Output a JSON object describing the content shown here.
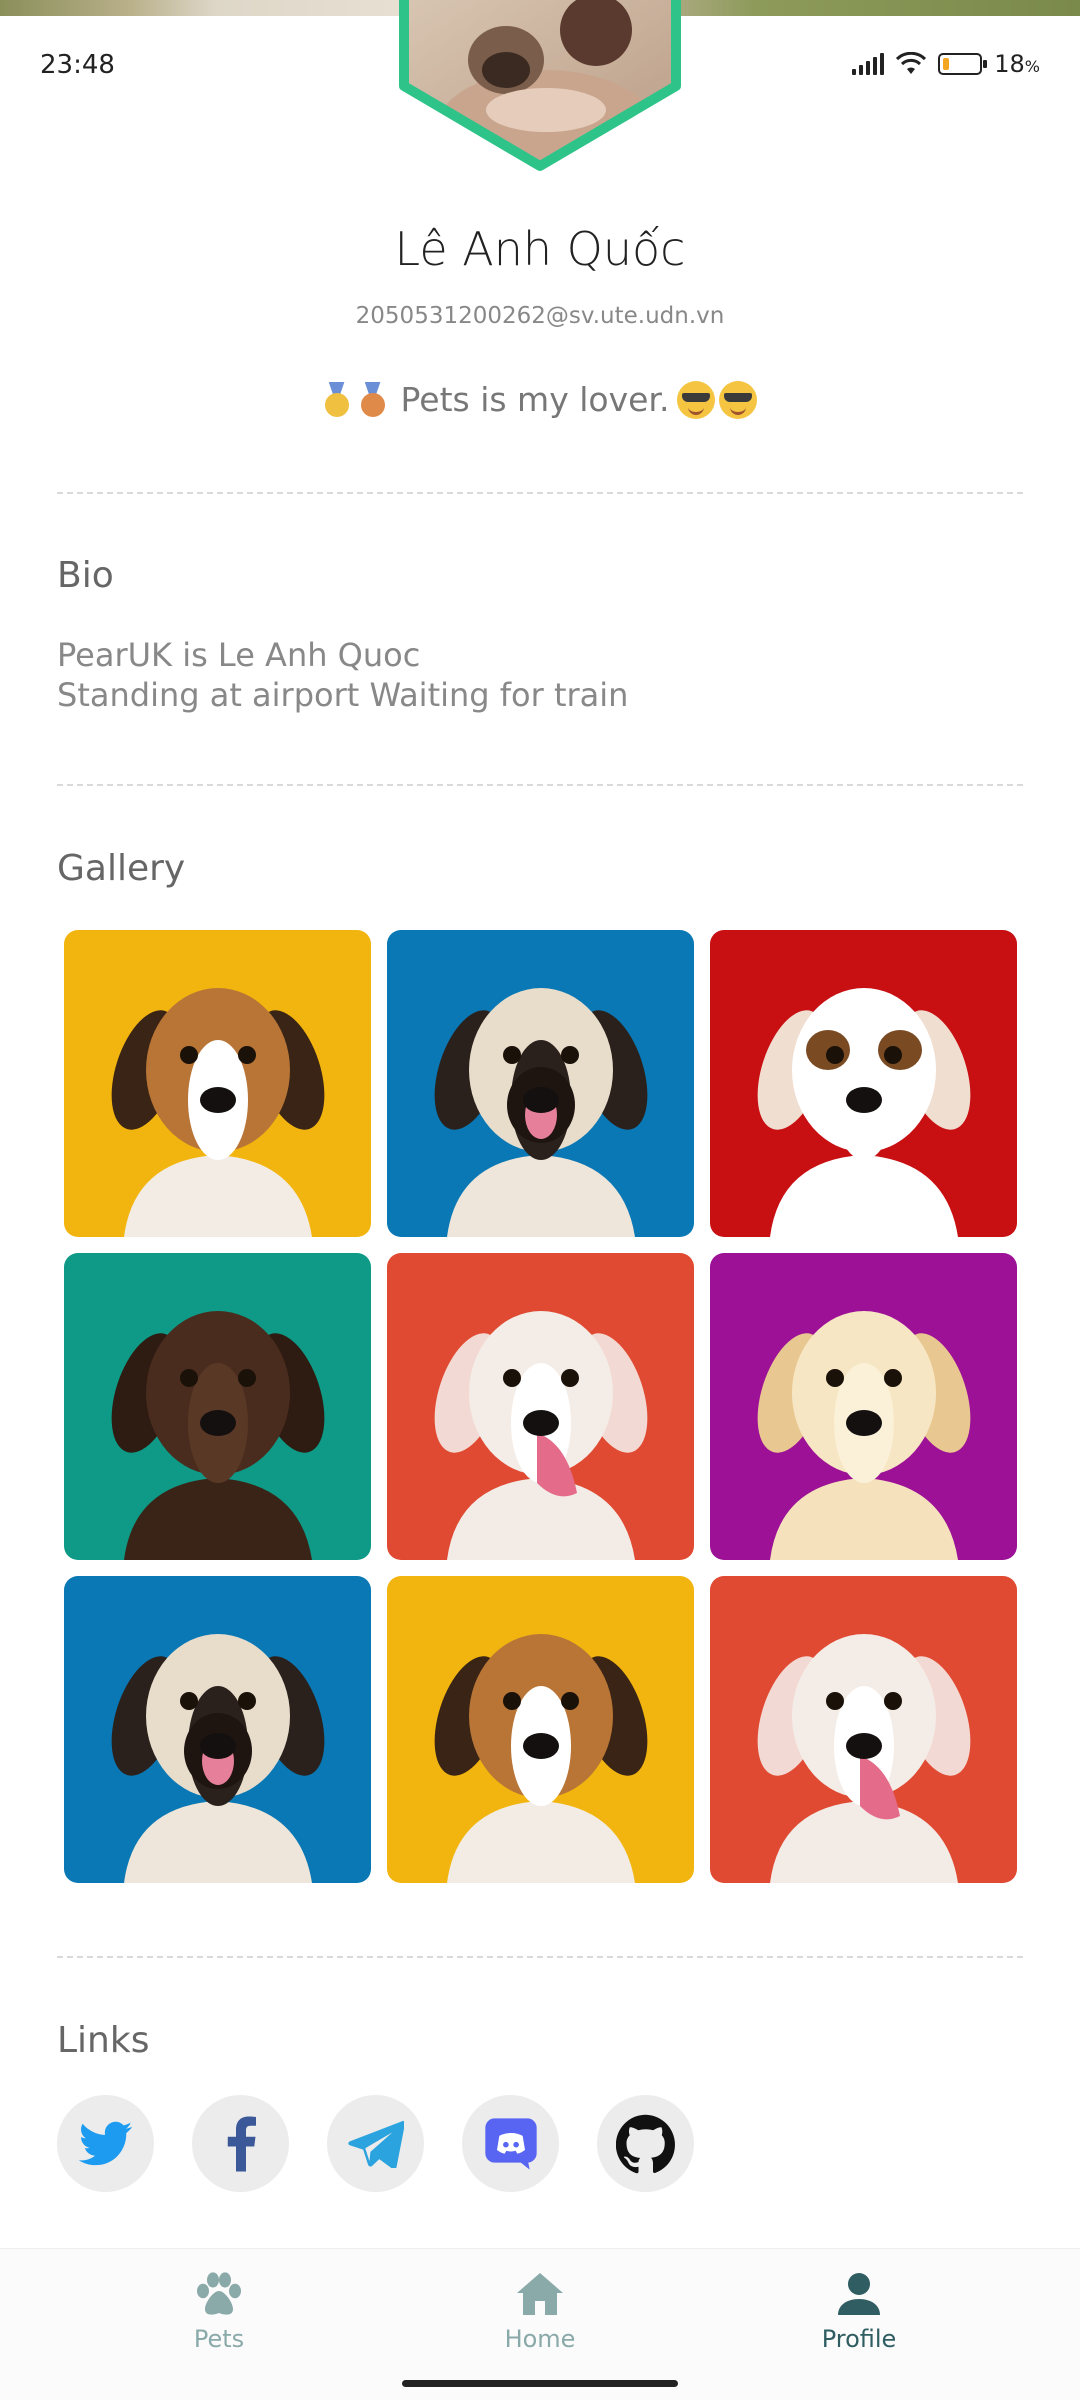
{
  "status_bar": {
    "time": "23:48",
    "battery": "18",
    "battery_unit": "%",
    "battery_level": 0.18
  },
  "profile": {
    "name": "Lê Anh Quốc",
    "email": "2050531200262@sv.ute.udn.vn",
    "tagline": "Pets is my lover."
  },
  "bio": {
    "title": "Bio",
    "lines": [
      "PearUK is Le Anh Quoc",
      "Standing at airport Waiting for train"
    ]
  },
  "gallery": {
    "title": "Gallery",
    "photos": [
      {
        "subject": "beagle-puppy",
        "background": "#f2b50f"
      },
      {
        "subject": "pug-puppy",
        "background": "#0a78b4"
      },
      {
        "subject": "jack-russell-puppy",
        "background": "#c80f12"
      },
      {
        "subject": "chocolate-lab-puppy",
        "background": "#0e9a86"
      },
      {
        "subject": "bulldog-puppy",
        "background": "#e04a32"
      },
      {
        "subject": "golden-retriever-puppy",
        "background": "#9c1196"
      },
      {
        "subject": "pug-puppy",
        "background": "#0a78b4"
      },
      {
        "subject": "beagle-puppy",
        "background": "#f2b50f"
      },
      {
        "subject": "bulldog-puppy",
        "background": "#e04a32"
      }
    ]
  },
  "links": {
    "title": "Links",
    "items": [
      {
        "name": "twitter",
        "color": "#1d9bf0"
      },
      {
        "name": "facebook",
        "color": "#3b5998"
      },
      {
        "name": "telegram",
        "color": "#2aa3df"
      },
      {
        "name": "discord",
        "color": "#5865f2"
      },
      {
        "name": "github",
        "color": "#111111"
      }
    ]
  },
  "nav": {
    "items": [
      {
        "label": "Pets",
        "icon": "paw-icon",
        "active": false
      },
      {
        "label": "Home",
        "icon": "home-icon",
        "active": false
      },
      {
        "label": "Profile",
        "icon": "person-icon",
        "active": true
      }
    ],
    "active_color": "#2f5d62",
    "inactive_color": "#8aa9a9"
  },
  "colors": {
    "accent": "#2ec489"
  }
}
